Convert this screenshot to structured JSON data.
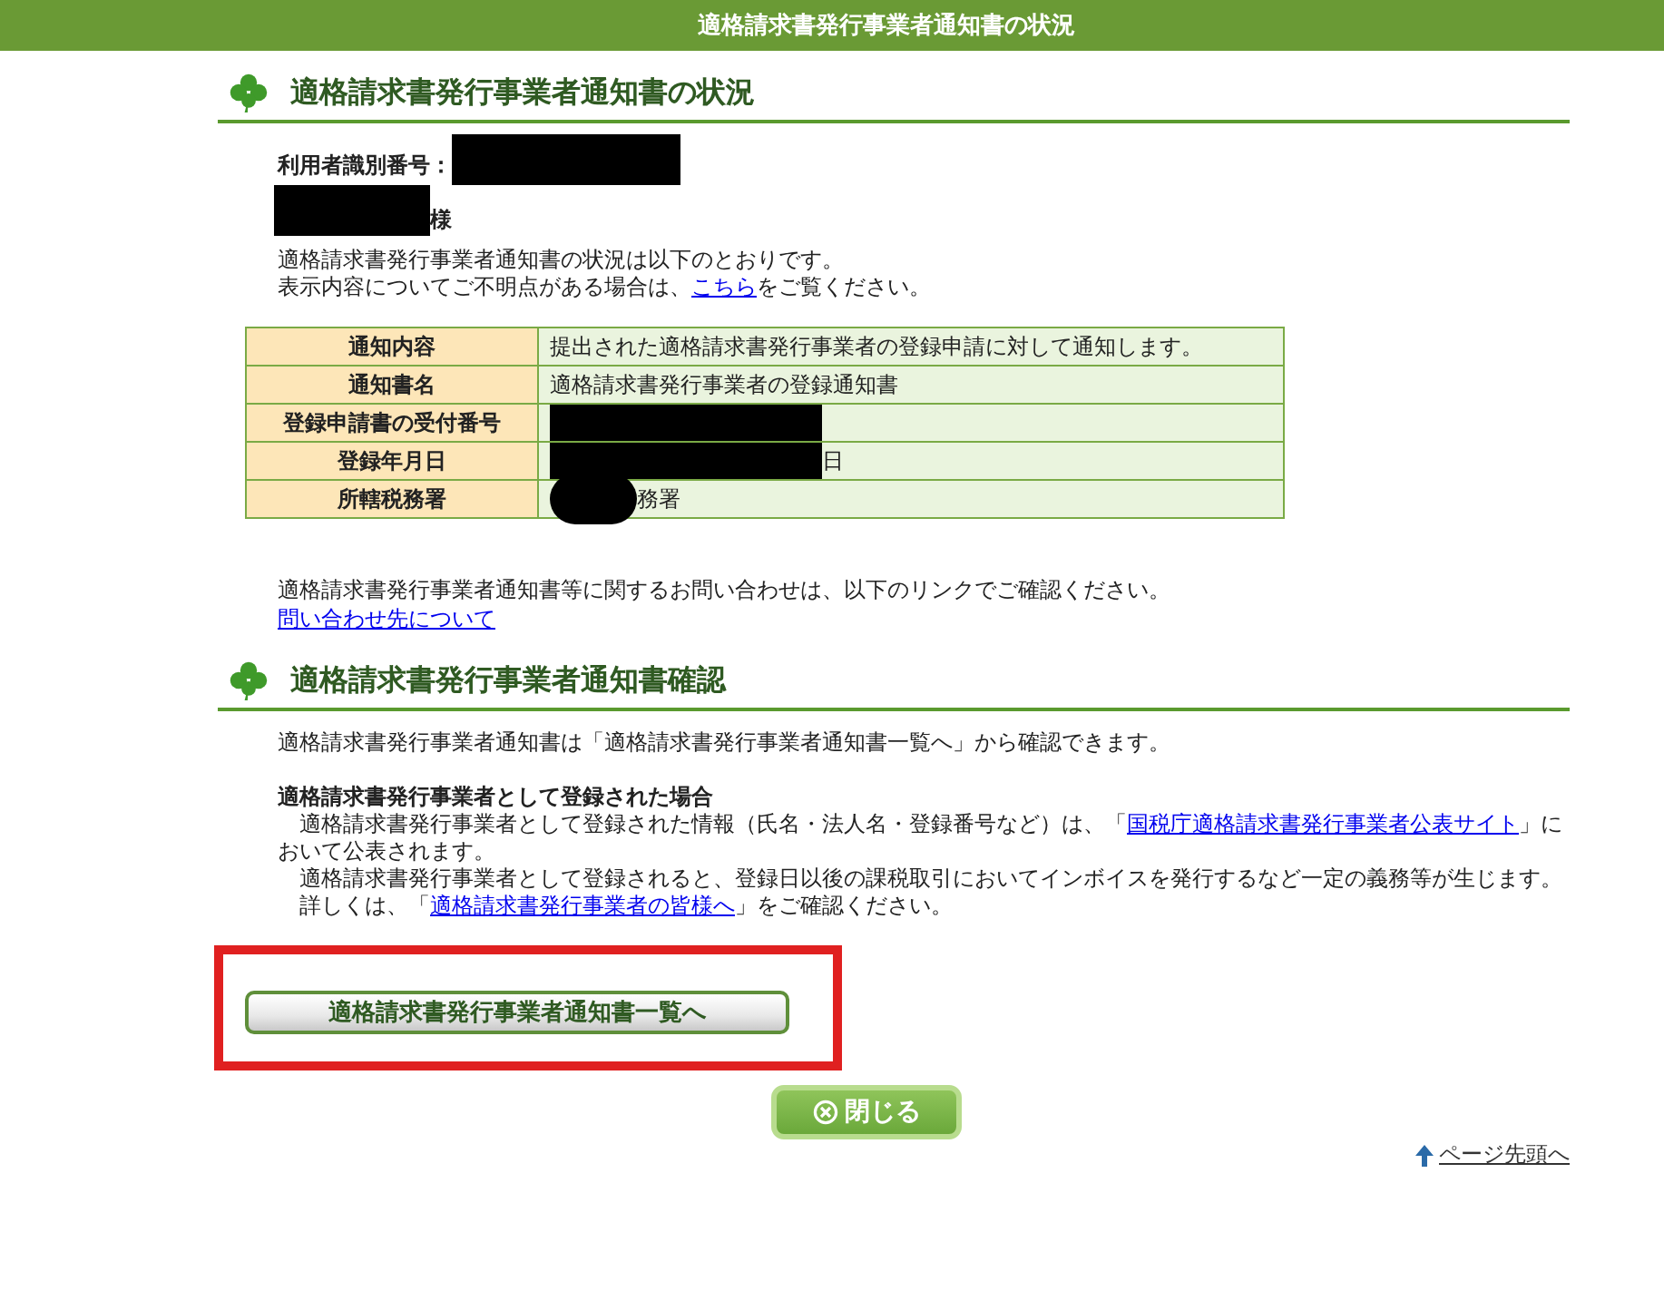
{
  "header": {
    "title": "適格請求書発行事業者通知書の状況"
  },
  "status_section": {
    "heading": "適格請求書発行事業者通知書の状況",
    "user_id_label": "利用者識別番号：",
    "user_name_suffix": "様",
    "intro": "適格請求書発行事業者通知書の状況は以下のとおりです。",
    "help": {
      "before": "表示内容についてご不明点がある場合は、",
      "link": "こちら",
      "after": "をご覧ください。"
    }
  },
  "table": {
    "rows": [
      {
        "label": "通知内容",
        "value": "提出された適格請求書発行事業者の登録申請に対して通知します。",
        "kind": "text"
      },
      {
        "label": "通知書名",
        "value": "適格請求書発行事業者の登録通知書",
        "kind": "text"
      },
      {
        "label": "登録申請書の受付番号",
        "kind": "redacted_bar"
      },
      {
        "label": "登録年月日",
        "value": "日",
        "kind": "redacted_bar"
      },
      {
        "label": "所轄税務署",
        "value": "務署",
        "kind": "redacted_blob"
      }
    ]
  },
  "inquiry": {
    "text": "適格請求書発行事業者通知書等に関するお問い合わせは、以下のリンクでご確認ください。",
    "link": "問い合わせ先について"
  },
  "confirm_section": {
    "heading": "適格請求書発行事業者通知書確認",
    "intro": "適格請求書発行事業者通知書は「適格請求書発行事業者通知書一覧へ」から確認できます。",
    "subheading": "適格請求書発行事業者として登録された場合",
    "paragraphs": [
      {
        "before": "適格請求書発行事業者として登録された情報（氏名・法人名・登録番号など）は、「",
        "link": "国税庁適格請求書発行事業者公表サイト",
        "after": "」において公表されます。"
      },
      {
        "before": "適格請求書発行事業者として登録されると、登録日以後の課税取引においてインボイスを発行するなど一定の義務等が生じます。"
      },
      {
        "before": "詳しくは、「",
        "link": "適格請求書発行事業者の皆様へ",
        "after": "」をご確認ください。"
      }
    ]
  },
  "list_button": {
    "label": "適格請求書発行事業者通知書一覧へ",
    "highlighted": true
  },
  "close_button": {
    "label": "閉じる"
  },
  "page_top_link": {
    "label": "ページ先頭へ"
  }
}
